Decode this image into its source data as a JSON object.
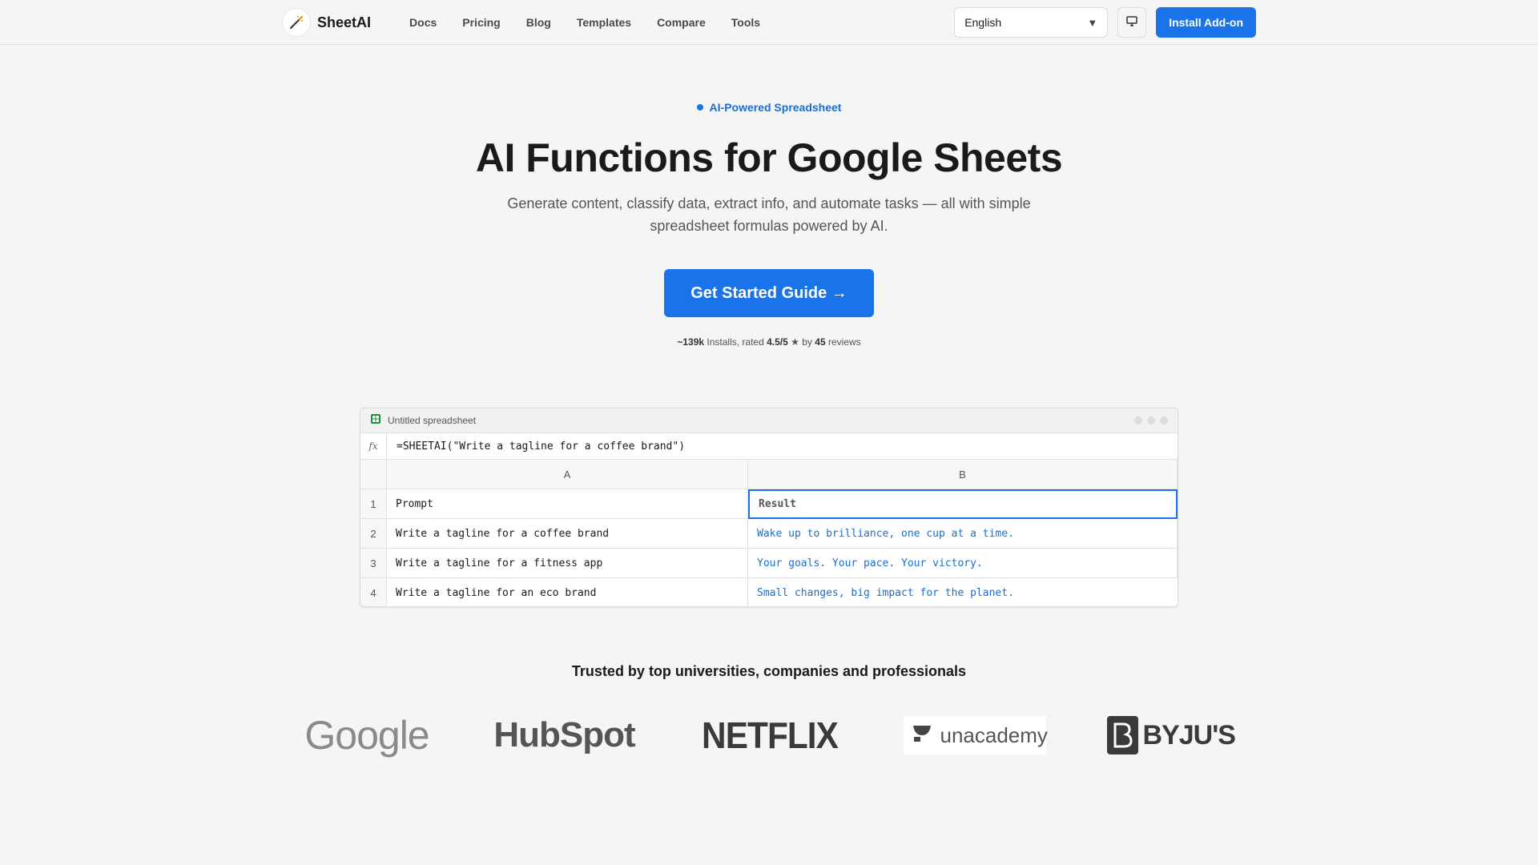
{
  "nav": {
    "brand": "SheetAI",
    "links": [
      "Docs",
      "Pricing",
      "Blog",
      "Templates",
      "Compare",
      "Tools"
    ],
    "language": "English",
    "install_label": "Install Add-on"
  },
  "hero": {
    "badge": "AI-Powered Spreadsheet",
    "title": "AI Functions for Google Sheets",
    "subtitle": "Generate content, classify data, extract info, and automate tasks — all with simple spreadsheet formulas powered by AI.",
    "cta_label": "Get Started Guide →",
    "stats": {
      "installs": "~139k",
      "installs_suffix": " Installs, rated ",
      "rating": "4.5/5",
      "star": "★",
      "by": " by ",
      "reviews": "45",
      "reviews_suffix": " reviews"
    }
  },
  "sheet": {
    "title": "Untitled spreadsheet",
    "formula_label": "fx",
    "formula": "=SHEETAI(\"Write a tagline for a coffee brand\")",
    "columns": [
      "A",
      "B"
    ],
    "rows": [
      {
        "num": "1",
        "a": "Prompt",
        "b": "Result"
      },
      {
        "num": "2",
        "a": "Write a tagline for a coffee brand",
        "b": "Wake up to brilliance, one cup at a time."
      },
      {
        "num": "3",
        "a": "Write a tagline for a fitness app",
        "b": "Your goals. Your pace. Your victory."
      },
      {
        "num": "4",
        "a": "Write a tagline for an eco brand",
        "b": "Small changes, big impact for the planet."
      }
    ]
  },
  "trust": {
    "heading": "Trusted by top universities, companies and professionals",
    "logos": [
      "Google",
      "HubSpot",
      "NETFLIX",
      "unacademy",
      "BYJU'S"
    ]
  },
  "colors": {
    "accent": "#1a73e8",
    "result_text": "#1a6fd0",
    "background": "#f5f5f5"
  }
}
